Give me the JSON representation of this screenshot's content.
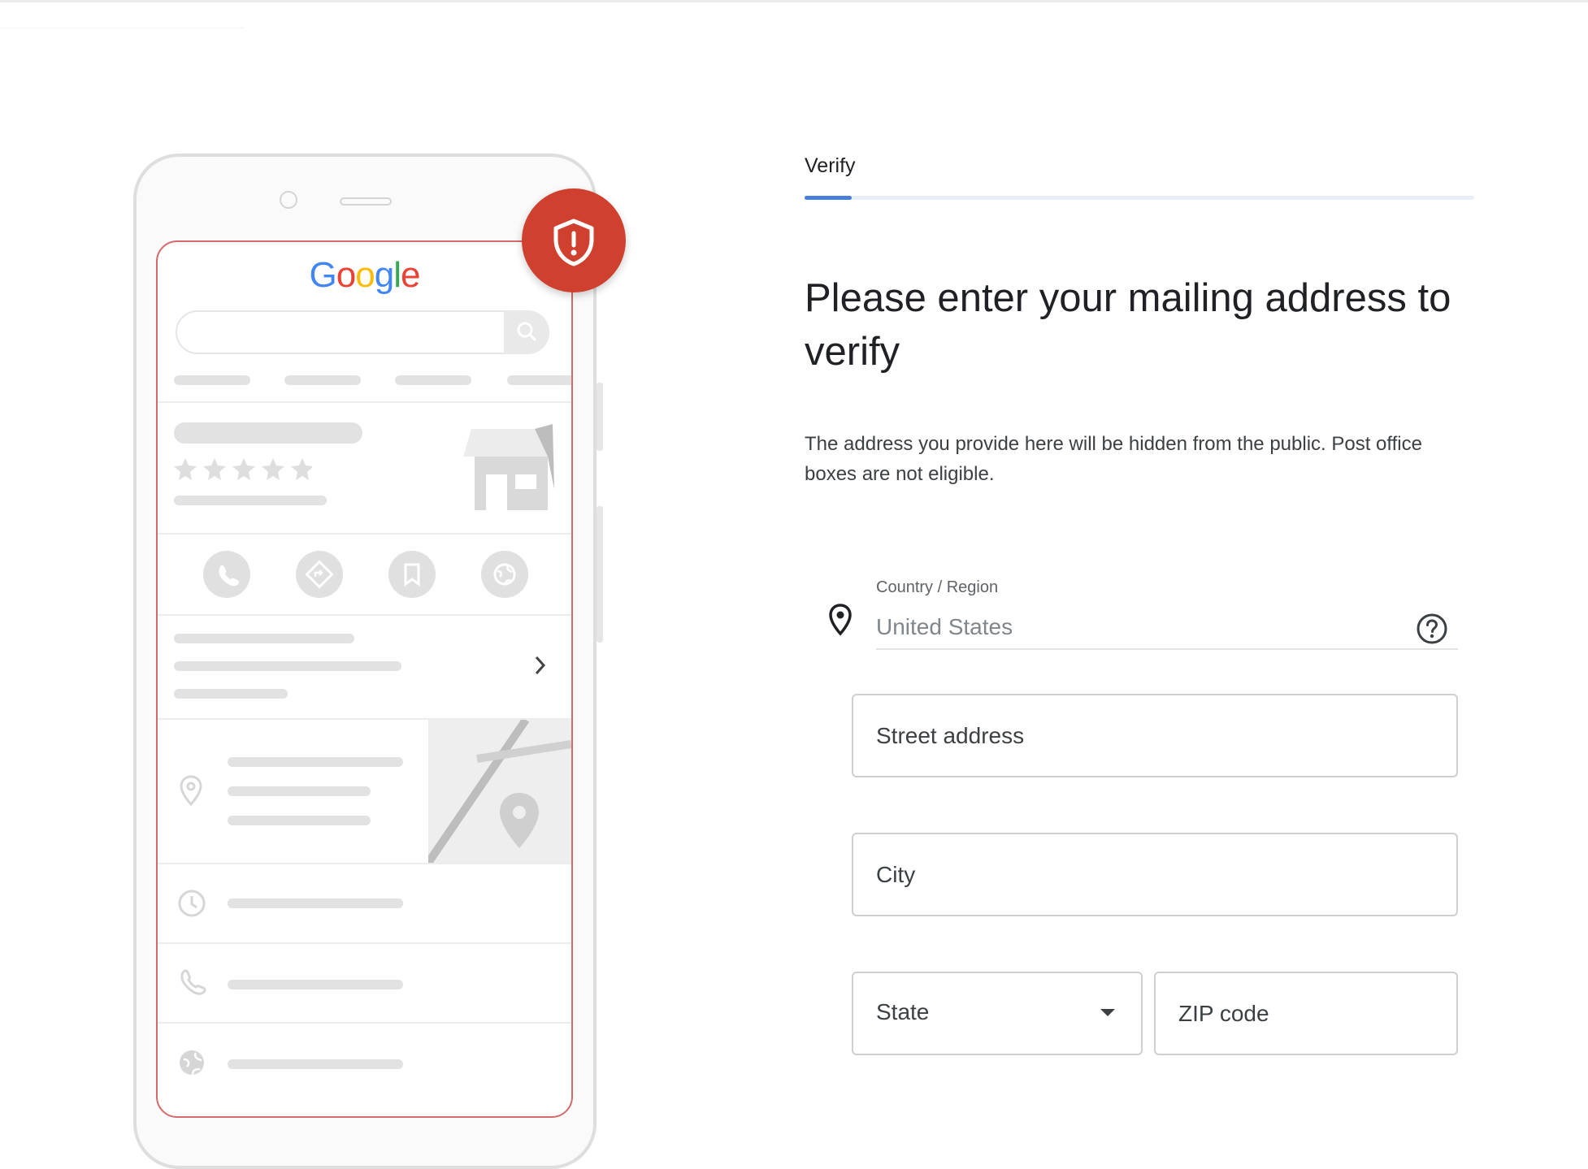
{
  "illustration": {
    "brand_logo": "Google"
  },
  "stepper": {
    "label": "Verify",
    "progress": 0.07
  },
  "form": {
    "title": "Please enter your mailing address to verify",
    "description": "The address you provide here will be hidden from the public. Post office boxes are not eligible.",
    "country": {
      "label": "Country / Region",
      "value": "United States"
    },
    "street": {
      "placeholder": "Street address"
    },
    "city": {
      "placeholder": "City"
    },
    "state": {
      "label": "State"
    },
    "zip": {
      "placeholder": "ZIP code"
    }
  },
  "colors": {
    "accent": "#4a7fd8",
    "alert_badge": "#d0402f",
    "screen_border": "#d46a6a"
  },
  "icons": {
    "pin": "location-pin-icon",
    "help": "help-circle-icon",
    "shield": "shield-alert-icon",
    "dropdown": "dropdown-arrow-icon"
  }
}
